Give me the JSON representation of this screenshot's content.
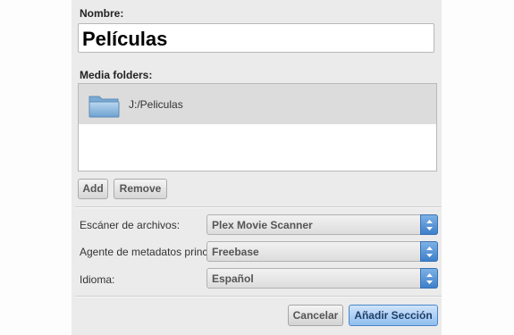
{
  "dialog": {
    "name_label": "Nombre:",
    "name_value": "Películas",
    "media_folders_label": "Media folders:",
    "folders": [
      {
        "icon": "folder-icon",
        "path": "J:/Peliculas"
      }
    ],
    "add_label": "Add",
    "remove_label": "Remove",
    "scanner_label": "Escáner de archivos:",
    "scanner_value": "Plex Movie Scanner",
    "agent_label": "Agente de metadatos principal:",
    "agent_value": "Freebase",
    "language_label": "Idioma:",
    "language_value": "Español",
    "cancel_label": "Cancelar",
    "submit_label": "Añadir Sección"
  },
  "colors": {
    "panel_bg": "#ebebeb",
    "selected_row": "#dcdcdc",
    "select_arrow": "#3d7fc9",
    "primary_button": "#8fbeef"
  }
}
